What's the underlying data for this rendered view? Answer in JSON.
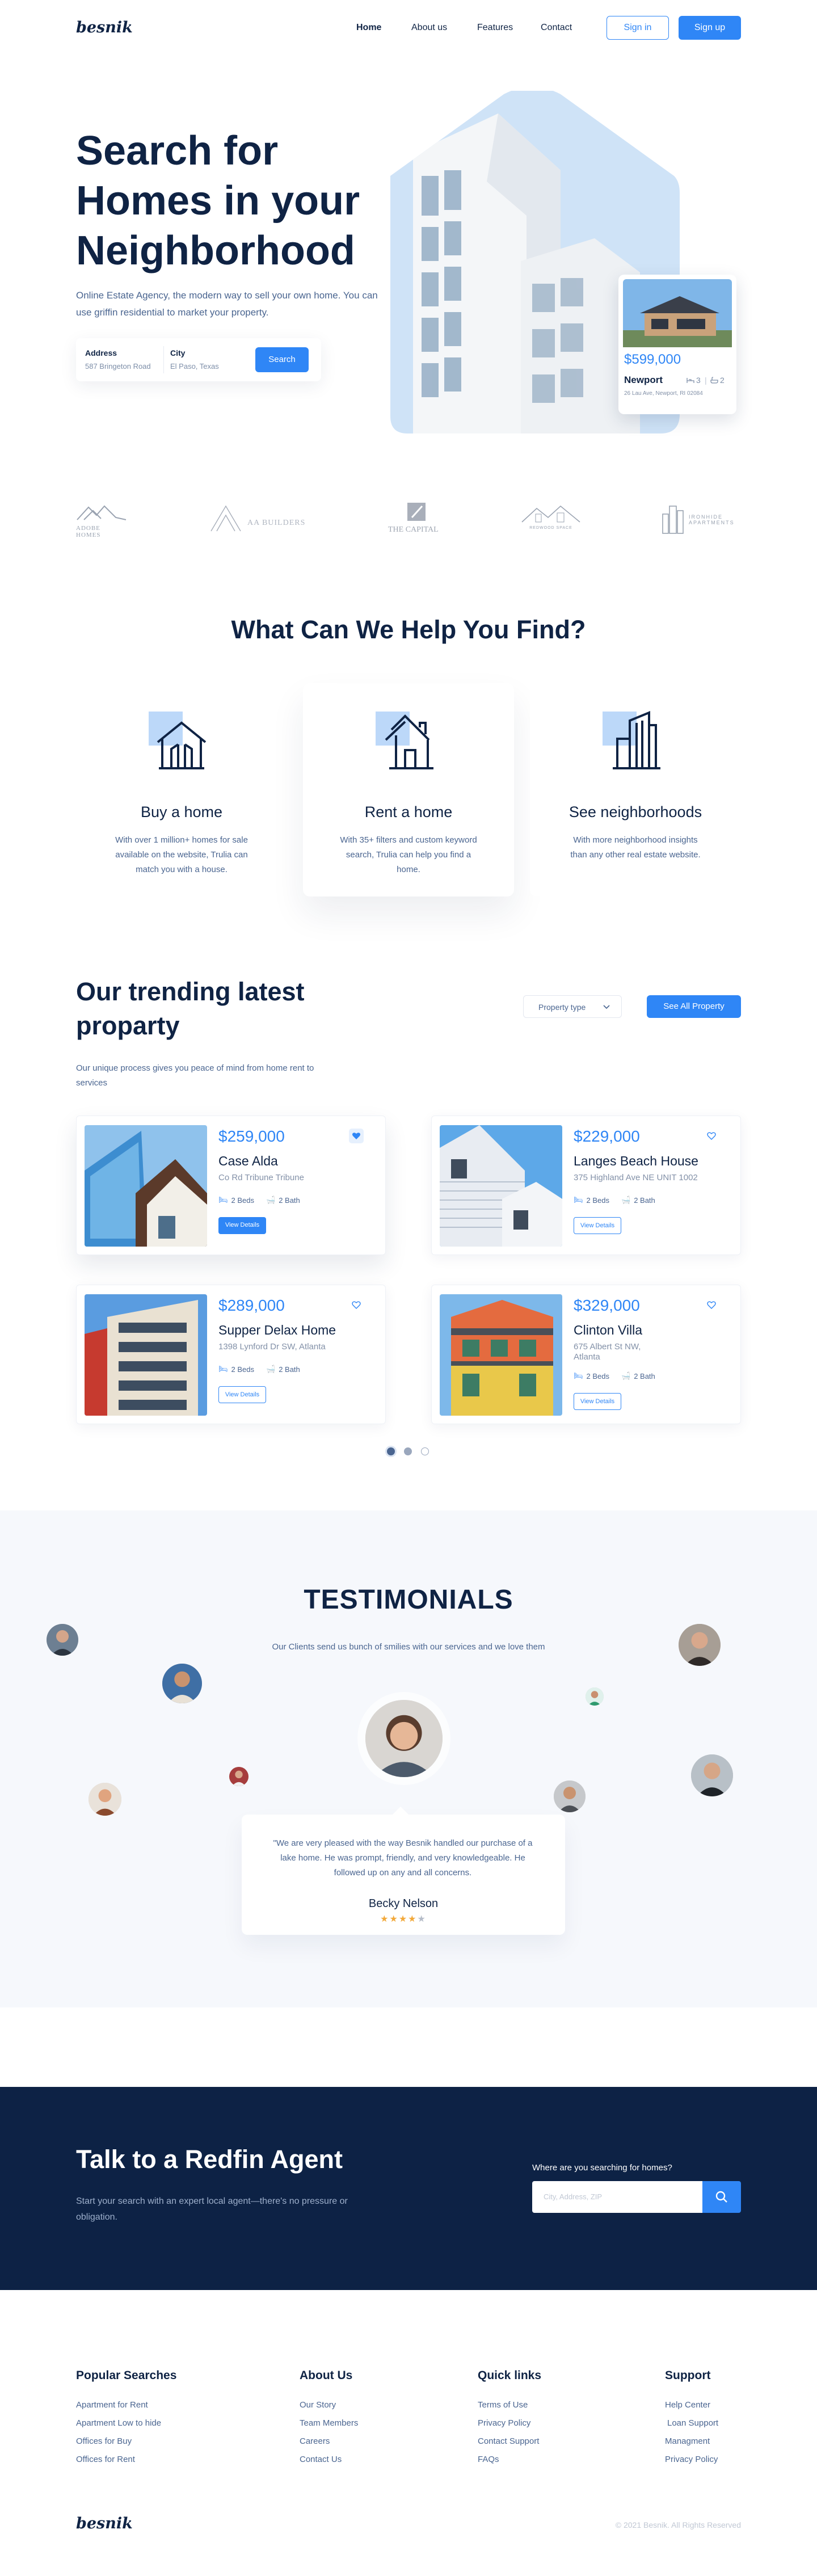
{
  "brand": {
    "logo": "besnik",
    "accent": "#2f86f6",
    "navy": "#0d2245"
  },
  "nav": {
    "links": [
      "Home",
      "About us",
      "Features",
      "Contact"
    ],
    "signin": "Sign in",
    "signup": "Sign up"
  },
  "hero": {
    "title": "Search for Homes in your Neighborhood",
    "subtitle": "Online Estate Agency, the modern way to sell your own home. You can use griffin residential to market your property.",
    "address_label": "Address",
    "address_value": "587 Bringeton Road",
    "city_label": "City",
    "city_value": "El Paso, Texas",
    "search_label": "Search",
    "featured": {
      "price": "$599,000",
      "name": "Newport",
      "address": "26 Lau Ave, Newport, RI 02084",
      "beds": "3",
      "baths": "2"
    }
  },
  "partners": [
    "ADOBE HOMES",
    "AA BUILDERS",
    "THE CAPITAL",
    "REDWOOD SPACE",
    "IRONHIDE APARTMENTS"
  ],
  "help": {
    "title": "What Can We Help You Find?",
    "cards": [
      {
        "icon": "house-icon",
        "title": "Buy a home",
        "desc": "With over 1 million+ homes for sale available on the website, Trulia can match you with a house."
      },
      {
        "icon": "rent-house-icon",
        "title": "Rent a home",
        "desc": "With 35+ filters and custom keyword search, Trulia can help you find a home."
      },
      {
        "icon": "buildings-icon",
        "title": "See neighborhoods",
        "desc": "With more neighborhood insights than any other real estate website."
      }
    ]
  },
  "trending": {
    "title": "Our trending latest proparty",
    "subtitle": "Our unique process gives you peace of mind from home rent to services",
    "filter_label": "Property type",
    "see_all": "See All Property",
    "cards": [
      {
        "price": "$259,000",
        "name": "Case Alda",
        "address": "Co Rd Tribune Tribune",
        "beds": "2 Beds",
        "baths": "2 Bath",
        "button": "View Details",
        "liked": true
      },
      {
        "price": "$229,000",
        "name": "Langes Beach House",
        "address": "375 Highland Ave NE UNIT 1002",
        "beds": "2 Beds",
        "baths": "2 Bath",
        "button": "View Details",
        "liked": false
      },
      {
        "price": "$289,000",
        "name": "Supper Delax Home",
        "address": "1398 Lynford Dr SW, Atlanta",
        "beds": "2 Beds",
        "baths": "2 Bath",
        "button": "View Details",
        "liked": false
      },
      {
        "price": "$329,000",
        "name": "Clinton Villa",
        "address": "675 Albert St NW, Atlanta",
        "beds": "2 Beds",
        "baths": "2 Bath",
        "button": "View Details",
        "liked": false
      }
    ]
  },
  "testimonials": {
    "title": "TESTIMONIALS",
    "subtitle": "Our Clients send us bunch of smilies with our services and we love them",
    "quote": "\"We are very pleased with the way Besnik handled our purchase of a lake home. He was prompt, friendly, and very knowledgeable. He followed up on any and all concerns.",
    "author": "Becky Nelson",
    "rating": 4,
    "rating_text": "★★★★★"
  },
  "cta": {
    "title": "Talk to a Redfin Agent",
    "subtitle": "Start your search with an expert local agent—there's no pressure or obligation.",
    "question": "Where are you searching for homes?",
    "placeholder": "City, Address, ZIP"
  },
  "footer": {
    "columns": [
      {
        "title": "Popular Searches",
        "links": [
          "Apartment for Rent",
          "Apartment Low to hide",
          "Offices for Buy",
          "Offices for Rent"
        ]
      },
      {
        "title": "About Us",
        "links": [
          "Our Story",
          "Team Members",
          "Careers",
          "Contact Us"
        ]
      },
      {
        "title": "Quick links",
        "links": [
          "Terms of Use",
          "Privacy Policy",
          "Contact Support",
          "FAQs"
        ]
      },
      {
        "title": "Support",
        "links": [
          "Help Center",
          "Loan Support",
          "Managment",
          "Privacy Policy"
        ]
      }
    ],
    "copyright": "© 2021 Besnik. All Rights Reserved"
  }
}
